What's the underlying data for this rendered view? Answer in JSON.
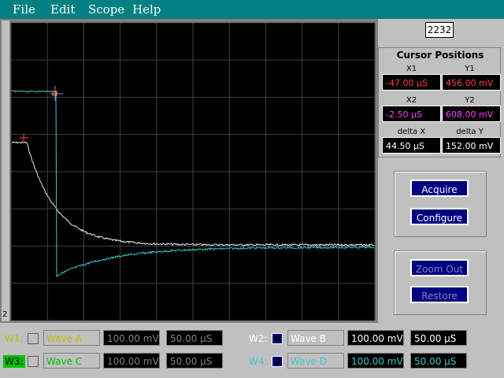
{
  "menu": {
    "file": "File",
    "edit": "Edit",
    "scope": "Scope",
    "help": "Help"
  },
  "counter": "2232",
  "cursor_panel": {
    "title": "Cursor Positions",
    "x1_label": "X1",
    "x1_value": "-47.00 µS",
    "y1_label": "Y1",
    "y1_value": "456.00 mV",
    "x2_label": "X2",
    "x2_value": "-2.50 µS",
    "y2_label": "Y2",
    "y2_value": "608.00 mV",
    "dx_label": "delta X",
    "dx_value": "44.50 µS",
    "dy_label": "delta Y",
    "dy_value": "152.00 mV"
  },
  "buttons": {
    "acquire": "Acquire",
    "configure": "Configure",
    "zoom_out": "Zoom Out",
    "restore": "Restore"
  },
  "waves": {
    "w1": {
      "label": "W1:",
      "name": "Wave A",
      "volts": "100.00 mV",
      "time": "50.00 µS",
      "color": "#c0c000",
      "enabled": false
    },
    "w2": {
      "label": "W2:",
      "name": "Wave B",
      "volts": "100.00 mV",
      "time": "50.00 µS",
      "color": "#ffffff",
      "enabled": true
    },
    "w3": {
      "label": "W3:",
      "name": "Wave C",
      "volts": "100.00 mV",
      "time": "50.00 µS",
      "color": "#00c000",
      "enabled": false
    },
    "w4": {
      "label": "W4:",
      "name": "Wave D",
      "volts": "100.00 mV",
      "time": "50.00 µS",
      "color": "#40c8c8",
      "enabled": true
    }
  },
  "plot_marker": "2",
  "colors": {
    "grid_bg": "#000000",
    "grid_line": "#404040",
    "trace_white": "#e8e8e8",
    "trace_cyan": "#40c8c8",
    "cursor1": "#ff4040",
    "cursor2": "#ff40ff",
    "accent": "#000080",
    "title_bar": "#008080"
  }
}
